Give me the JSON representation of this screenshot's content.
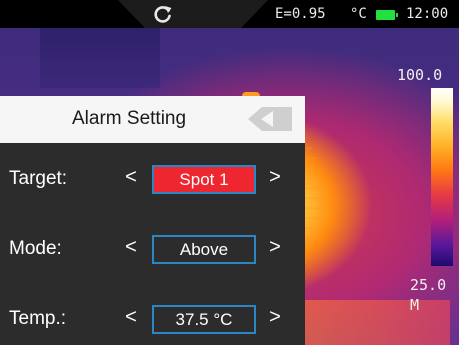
{
  "status_bar": {
    "emissivity": "E=0.95",
    "unit": "°C",
    "time": "12:00",
    "icons": [
      "refresh-icon",
      "battery-icon"
    ],
    "battery_color": "#22e040"
  },
  "color_scale": {
    "max": "100.0",
    "min": "25.0",
    "mode": "M"
  },
  "alarm_panel": {
    "title": "Alarm Setting",
    "back_icon": "back-arrow-icon",
    "rows": [
      {
        "label": "Target:",
        "value": "Spot 1",
        "selected": true
      },
      {
        "label": "Mode:",
        "value": "Above",
        "selected": false
      },
      {
        "label": "Temp.:",
        "value": "37.5 °C",
        "selected": false
      }
    ],
    "left_arrow": "<",
    "right_arrow": ">",
    "colors": {
      "selected_fill": "#ee2630",
      "box_border": "#2a86c4",
      "panel_background": "#2c2c2c",
      "header_background": "#f6f6f6"
    }
  }
}
